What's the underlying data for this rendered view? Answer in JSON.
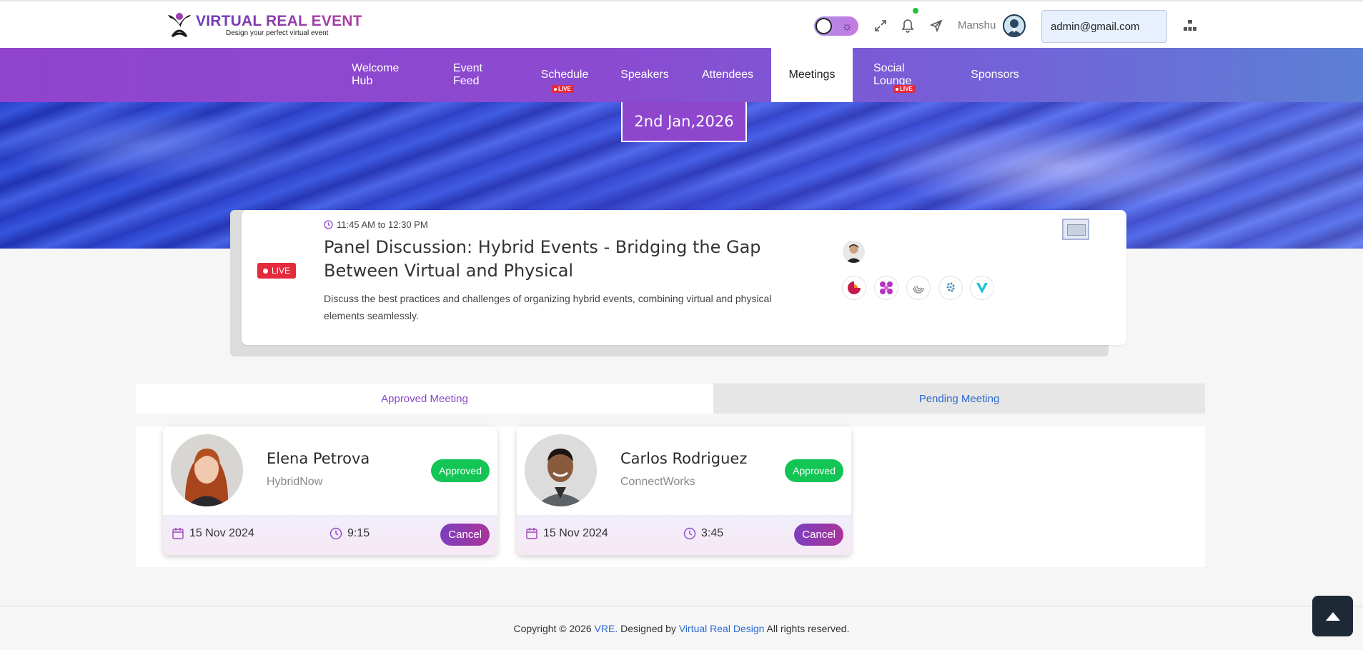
{
  "brand": {
    "title": "VIRTUAL REAL EVENT",
    "tagline": "Design your perfect virtual event"
  },
  "header": {
    "username": "Manshu",
    "email_value": "admin@gmail.com"
  },
  "nav": {
    "items": [
      {
        "label": "Welcome Hub"
      },
      {
        "label": "Event Feed"
      },
      {
        "label": "Schedule",
        "badge": "LIVE"
      },
      {
        "label": "Speakers"
      },
      {
        "label": "Attendees"
      },
      {
        "label": "Meetings",
        "active": true
      },
      {
        "label": "Social Lounge",
        "badge": "LIVE"
      },
      {
        "label": "Sponsors"
      }
    ]
  },
  "hero": {
    "date": "2nd Jan,2026"
  },
  "session": {
    "live_label": "LIVE",
    "time": "11:45 AM to 12:30 PM",
    "title": "Panel Discussion: Hybrid Events - Bridging the Gap Between Virtual and Physical",
    "description": "Discuss the best practices and challenges of organizing hybrid events, combining virtual and physical elements seamlessly."
  },
  "tabs": {
    "approved": "Approved Meeting",
    "pending": "Pending Meeting"
  },
  "meetings": [
    {
      "name": "Elena Petrova",
      "company": "HybridNow",
      "status": "Approved",
      "date": "15 Nov 2024",
      "time": "9:15",
      "action": "Cancel"
    },
    {
      "name": "Carlos Rodriguez",
      "company": "ConnectWorks",
      "status": "Approved",
      "date": "15 Nov 2024",
      "time": "3:45",
      "action": "Cancel"
    }
  ],
  "footer": {
    "prefix": "Copyright © 2026 ",
    "brand_link": "VRE.",
    "middle": " Designed by ",
    "designer_link": "Virtual Real Design",
    "suffix": " All rights reserved."
  },
  "colors": {
    "accent": "#8c49c9",
    "live": "#e42b3d",
    "approved": "#12c554",
    "link": "#2d6bd1"
  }
}
